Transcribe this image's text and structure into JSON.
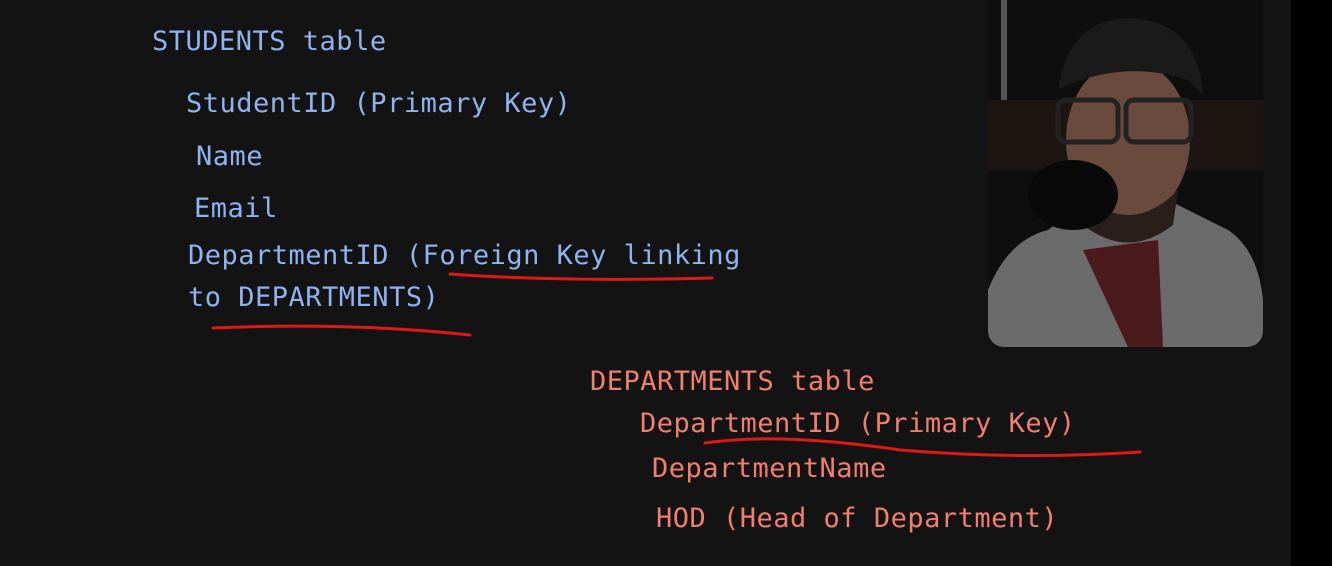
{
  "students": {
    "title": "STUDENTS table",
    "fields": [
      "StudentID (Primary Key)",
      "Name",
      "Email",
      "DepartmentID (Foreign Key linking",
      "to DEPARTMENTS)"
    ]
  },
  "departments": {
    "title": "DEPARTMENTS table",
    "fields": [
      "DepartmentID (Primary Key)",
      "DepartmentName",
      "HOD (Head of Department)"
    ]
  },
  "colors": {
    "students": "#8eb3ef",
    "departments": "#f07f6f",
    "underline": "#e01818",
    "background": "#131313"
  }
}
